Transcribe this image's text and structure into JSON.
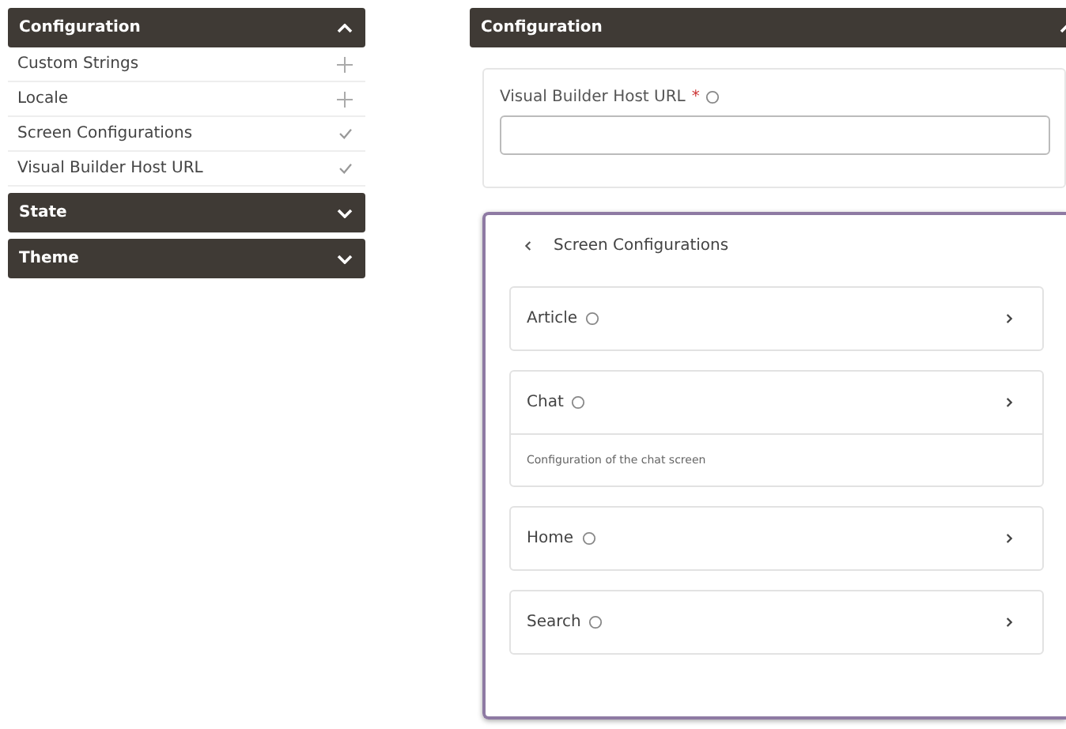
{
  "sidebar": {
    "sections": [
      {
        "title": "Configuration",
        "expanded": true,
        "items": [
          {
            "label": "Custom Strings",
            "configured": false
          },
          {
            "label": "Locale",
            "configured": false
          },
          {
            "label": "Screen Configurations",
            "configured": true
          },
          {
            "label": "Visual Builder Host URL",
            "configured": true
          }
        ]
      },
      {
        "title": "State",
        "expanded": false
      },
      {
        "title": "Theme",
        "expanded": false
      }
    ]
  },
  "panel": {
    "title": "Configuration",
    "expanded": true,
    "field": {
      "label": "Visual Builder Host URL",
      "required_mark": "*"
    },
    "subpage": {
      "title": "Screen Configurations",
      "items": [
        {
          "label": "Article",
          "expanded": false
        },
        {
          "label": "Chat",
          "expanded": true,
          "description": "Configuration of the chat screen"
        },
        {
          "label": "Home",
          "expanded": false
        },
        {
          "label": "Search",
          "expanded": false
        }
      ]
    }
  }
}
